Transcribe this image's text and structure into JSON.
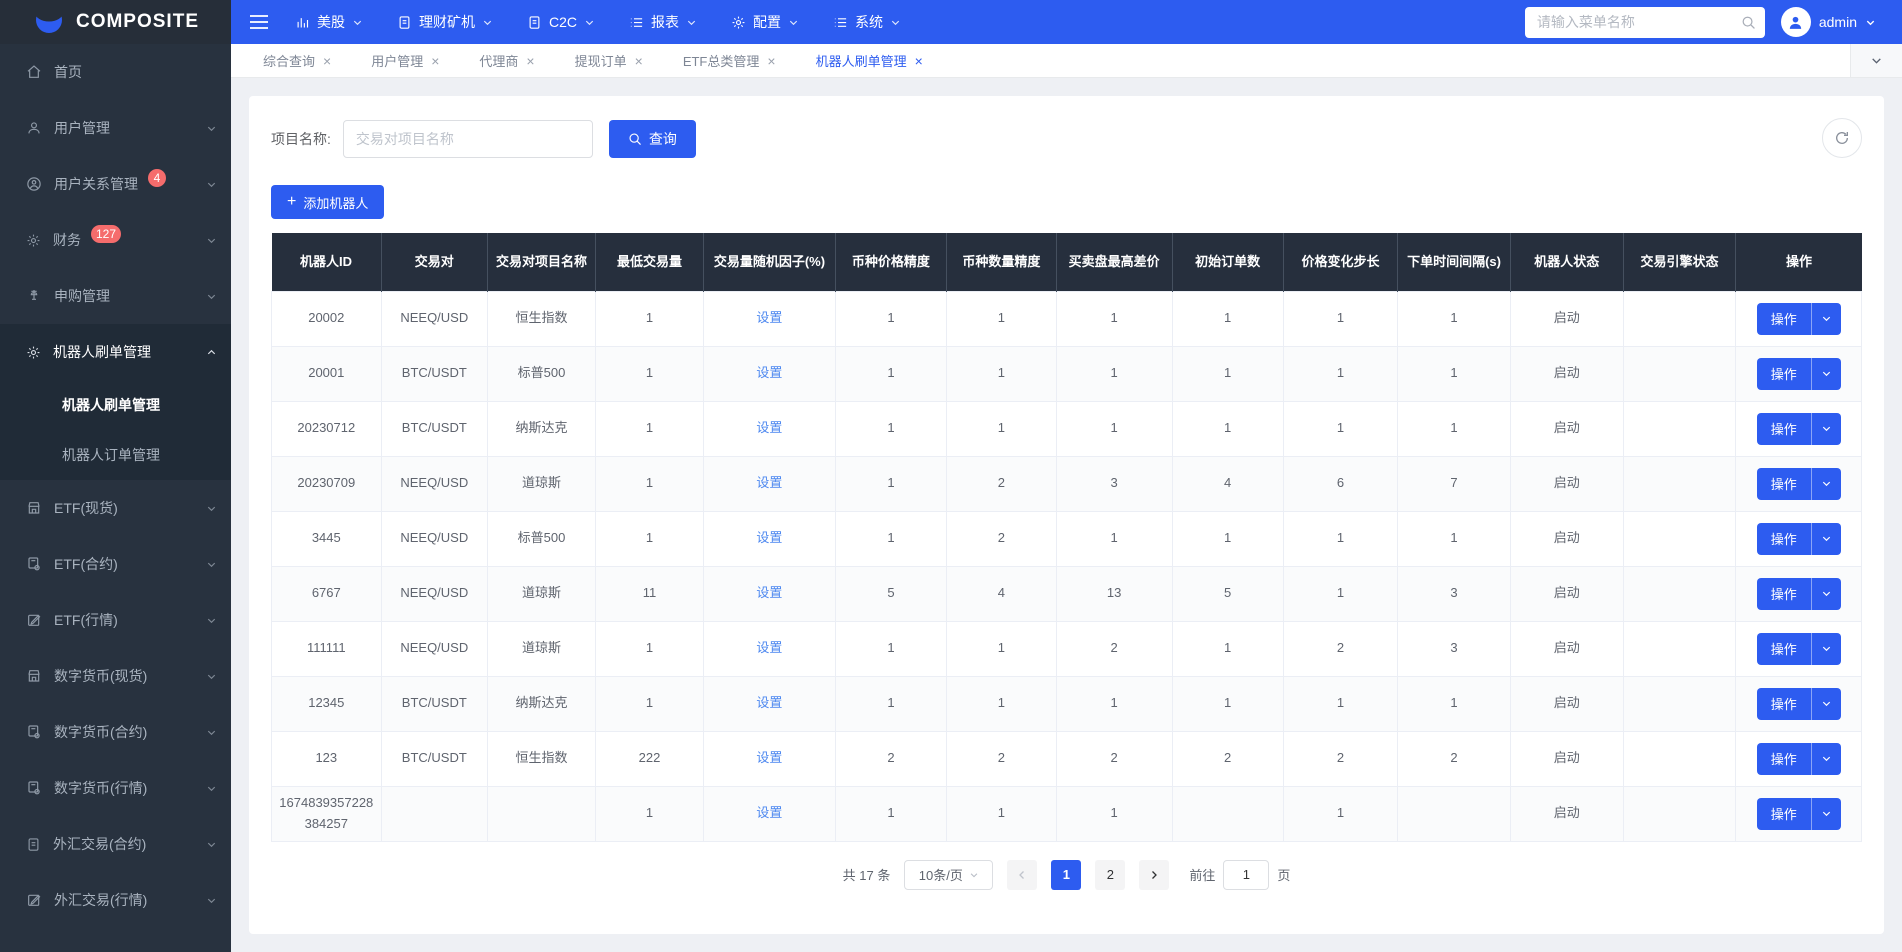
{
  "brand": {
    "name": "COMPOSITE"
  },
  "topbar": {
    "nav": [
      {
        "label": "美股",
        "icon": "chart"
      },
      {
        "label": "理财矿机",
        "icon": "doc"
      },
      {
        "label": "C2C",
        "icon": "doc"
      },
      {
        "label": "报表",
        "icon": "list"
      },
      {
        "label": "配置",
        "icon": "gear"
      },
      {
        "label": "系统",
        "icon": "list"
      }
    ],
    "search_placeholder": "请输入菜单名称",
    "user": "admin"
  },
  "sidebar": {
    "items": [
      {
        "label": "首页",
        "icon": "home",
        "arrow": ""
      },
      {
        "label": "用户管理",
        "icon": "user",
        "arrow": "down"
      },
      {
        "label": "用户关系管理",
        "icon": "user-circle",
        "badge": "4",
        "arrow": "down"
      },
      {
        "label": "财务",
        "icon": "gear",
        "badge": "127",
        "arrow": "down"
      },
      {
        "label": "申购管理",
        "icon": "tool",
        "arrow": "down"
      },
      {
        "label": "机器人刷单管理",
        "icon": "gear",
        "arrow": "up",
        "expanded": true,
        "children": [
          {
            "label": "机器人刷单管理",
            "active": true
          },
          {
            "label": "机器人订单管理",
            "active": false
          }
        ]
      },
      {
        "label": "ETF(现货)",
        "icon": "store",
        "arrow": "down"
      },
      {
        "label": "ETF(合约)",
        "icon": "doc-gear",
        "arrow": "down"
      },
      {
        "label": "ETF(行情)",
        "icon": "edit",
        "arrow": "down"
      },
      {
        "label": "数字货币(现货)",
        "icon": "store",
        "arrow": "down"
      },
      {
        "label": "数字货币(合约)",
        "icon": "doc-gear",
        "arrow": "down"
      },
      {
        "label": "数字货币(行情)",
        "icon": "doc-gear",
        "arrow": "down"
      },
      {
        "label": "外汇交易(合约)",
        "icon": "doc",
        "arrow": "down"
      },
      {
        "label": "外汇交易(行情)",
        "icon": "edit",
        "arrow": "down"
      }
    ]
  },
  "tabs": [
    {
      "label": "综合查询",
      "active": false
    },
    {
      "label": "用户管理",
      "active": false
    },
    {
      "label": "代理商",
      "active": false
    },
    {
      "label": "提现订单",
      "active": false
    },
    {
      "label": "ETF总类管理",
      "active": false
    },
    {
      "label": "机器人刷单管理",
      "active": true
    }
  ],
  "filter": {
    "label": "项目名称:",
    "placeholder": "交易对项目名称",
    "search_button": "查询"
  },
  "add_button_label": "添加机器人",
  "table": {
    "headers": [
      "机器人ID",
      "交易对",
      "交易对项目名称",
      "最低交易量",
      "交易量随机因子(%)",
      "币种价格精度",
      "币种数量精度",
      "买卖盘最高差价",
      "初始订单数",
      "价格变化步长",
      "下单时间间隔(s)",
      "机器人状态",
      "交易引擎状态",
      "操作"
    ],
    "settings_label": "设置",
    "action_label": "操作",
    "rows": [
      {
        "id": "20002",
        "pair": "NEEQ/USD",
        "project": "恒生指数",
        "min_volume": "1",
        "price_precision": "1",
        "qty_precision": "1",
        "max_spread": "1",
        "init_orders": "1",
        "price_step": "1",
        "interval": "1",
        "robot_status": "启动",
        "engine_status": ""
      },
      {
        "id": "20001",
        "pair": "BTC/USDT",
        "project": "标普500",
        "min_volume": "1",
        "price_precision": "1",
        "qty_precision": "1",
        "max_spread": "1",
        "init_orders": "1",
        "price_step": "1",
        "interval": "1",
        "robot_status": "启动",
        "engine_status": ""
      },
      {
        "id": "20230712",
        "pair": "BTC/USDT",
        "project": "纳斯达克",
        "min_volume": "1",
        "price_precision": "1",
        "qty_precision": "1",
        "max_spread": "1",
        "init_orders": "1",
        "price_step": "1",
        "interval": "1",
        "robot_status": "启动",
        "engine_status": ""
      },
      {
        "id": "20230709",
        "pair": "NEEQ/USD",
        "project": "道琼斯",
        "min_volume": "1",
        "price_precision": "1",
        "qty_precision": "2",
        "max_spread": "3",
        "init_orders": "4",
        "price_step": "6",
        "interval": "7",
        "robot_status": "启动",
        "engine_status": ""
      },
      {
        "id": "3445",
        "pair": "NEEQ/USD",
        "project": "标普500",
        "min_volume": "1",
        "price_precision": "1",
        "qty_precision": "2",
        "max_spread": "1",
        "init_orders": "1",
        "price_step": "1",
        "interval": "1",
        "robot_status": "启动",
        "engine_status": ""
      },
      {
        "id": "6767",
        "pair": "NEEQ/USD",
        "project": "道琼斯",
        "min_volume": "11",
        "price_precision": "5",
        "qty_precision": "4",
        "max_spread": "13",
        "init_orders": "5",
        "price_step": "1",
        "interval": "3",
        "robot_status": "启动",
        "engine_status": ""
      },
      {
        "id": "111111",
        "pair": "NEEQ/USD",
        "project": "道琼斯",
        "min_volume": "1",
        "price_precision": "1",
        "qty_precision": "1",
        "max_spread": "2",
        "init_orders": "1",
        "price_step": "2",
        "interval": "3",
        "robot_status": "启动",
        "engine_status": ""
      },
      {
        "id": "12345",
        "pair": "BTC/USDT",
        "project": "纳斯达克",
        "min_volume": "1",
        "price_precision": "1",
        "qty_precision": "1",
        "max_spread": "1",
        "init_orders": "1",
        "price_step": "1",
        "interval": "1",
        "robot_status": "启动",
        "engine_status": ""
      },
      {
        "id": "123",
        "pair": "BTC/USDT",
        "project": "恒生指数",
        "min_volume": "222",
        "price_precision": "2",
        "qty_precision": "2",
        "max_spread": "2",
        "init_orders": "2",
        "price_step": "2",
        "interval": "2",
        "robot_status": "启动",
        "engine_status": ""
      },
      {
        "id": "1674839357228384257",
        "pair": "",
        "project": "",
        "min_volume": "1",
        "price_precision": "1",
        "qty_precision": "1",
        "max_spread": "1",
        "init_orders": "",
        "price_step": "1",
        "interval": "",
        "robot_status": "启动",
        "engine_status": ""
      }
    ]
  },
  "pagination": {
    "total": "共 17 条",
    "page_size": "10条/页",
    "pages": [
      "1",
      "2"
    ],
    "active_page": "1",
    "goto_label": "前往",
    "goto_value": "1",
    "unit_label": "页"
  },
  "colors": {
    "accent": "#2d5cf0",
    "sidebar_bg": "#28323f",
    "table_header_bg": "#262f3d",
    "badge": "#f56c6c",
    "link": "#4d88f0"
  }
}
